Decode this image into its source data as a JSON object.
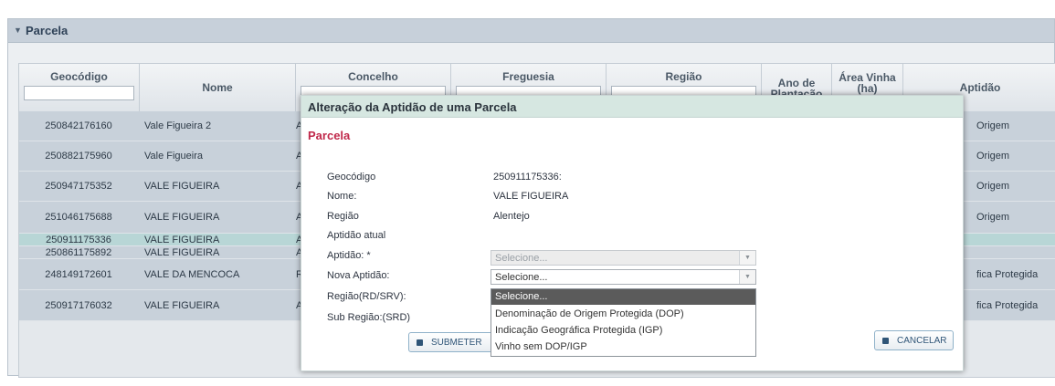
{
  "panel": {
    "title": "Parcela"
  },
  "grid": {
    "columns": {
      "geocodigo": "Geocódigo",
      "nome": "Nome",
      "concelho": "Concelho",
      "freguesia": "Freguesia",
      "regiao": "Região",
      "ano_line1": "Ano de",
      "ano_line2": "Plantação",
      "area_line1": "Área Vinha",
      "area_line2": "(ha)",
      "aptidao": "Aptidão"
    },
    "rows": [
      {
        "geo": "250842176160",
        "nome": "Vale Figueira 2",
        "conc": "Al",
        "apt": "Origem"
      },
      {
        "geo": "250882175960",
        "nome": "Vale Figueira",
        "conc": "Al",
        "apt": "Origem"
      },
      {
        "geo": "250947175352",
        "nome": "VALE FIGUEIRA",
        "conc": "Al",
        "apt": "Origem"
      },
      {
        "geo": "251046175688",
        "nome": "VALE FIGUEIRA",
        "conc": "Al",
        "apt": "Origem"
      },
      {
        "geo": "250911175336",
        "nome": "VALE FIGUEIRA",
        "conc": "Al",
        "apt": ""
      },
      {
        "geo": "250861175892",
        "nome": "VALE FIGUEIRA",
        "conc": "Al",
        "apt": ""
      },
      {
        "geo": "248149172601",
        "nome": "VALE DA MENCOCA",
        "conc": "Re",
        "apt": "fica Protegida"
      },
      {
        "geo": "250917176032",
        "nome": "VALE FIGUEIRA",
        "conc": "Al",
        "apt": "fica Protegida"
      }
    ]
  },
  "modal": {
    "title": "Alteração da Aptidão de uma Parcela",
    "section": "Parcela",
    "labels": {
      "geocodigo": "Geocódigo",
      "nome": "Nome:",
      "regiao": "Região",
      "aptidao_atual": "Aptidão atual",
      "aptidao": "Aptidão: *",
      "nova_aptidao": "Nova Aptidão:",
      "regiao_rd": "Região(RD/SRV):",
      "sub_regiao": "Sub Região:(SRD)"
    },
    "values": {
      "geocodigo": "250911175336:",
      "nome": "VALE FIGUEIRA",
      "regiao": "Alentejo"
    },
    "aptidao_select": "Selecione...",
    "nova_aptidao_select": "Selecione...",
    "dropdown_options": [
      "Selecione...",
      "Denominação de Origem Protegida (DOP)",
      "Indicação Geográfica Protegida (IGP)",
      "Vinho sem DOP/IGP"
    ],
    "submit_label": "SUBMETER",
    "cancel_label": "CANCELAR"
  },
  "icons": {
    "panel_toggle": "chevron-down-icon",
    "select_arrow": "triangle-down-icon",
    "button_icon": "save-icon"
  },
  "colors": {
    "header_bg": "#c7d0da",
    "selected_row": "#b8d6d6",
    "modal_header": "#d6e7e1",
    "section_title": "#c0284a",
    "highlight_option": "#5b5b5b"
  }
}
